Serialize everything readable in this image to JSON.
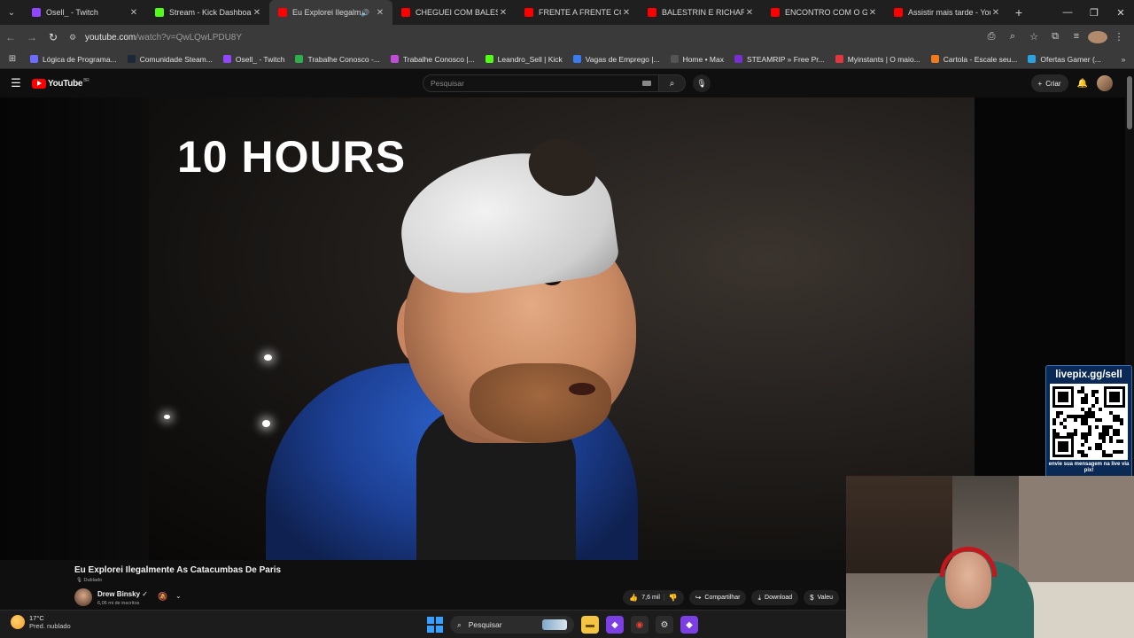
{
  "tabs": [
    {
      "label": "Osell_ - Twitch",
      "type": "twitch",
      "active": false
    },
    {
      "label": "Stream - Kick Dashboard",
      "type": "kick",
      "active": false
    },
    {
      "label": "Eu Explorei Ilegalmen",
      "type": "yt",
      "active": true
    },
    {
      "label": "CHEGUEI COM BALESTRIN",
      "type": "yt",
      "active": false
    },
    {
      "label": "FRENTE A FRENTE COM O",
      "type": "yt",
      "active": false
    },
    {
      "label": "BALESTRIN E RICHARD E",
      "type": "yt",
      "active": false
    },
    {
      "label": "ENCONTRO COM O GIGA",
      "type": "yt",
      "active": false
    },
    {
      "label": "Assistir mais tarde - YouT",
      "type": "yt",
      "active": false
    }
  ],
  "address": {
    "host": "youtube.com",
    "path": "/watch?v=QwLQwLPDU8Y"
  },
  "bookmarks": [
    {
      "label": "Lógica de Programa...",
      "color": "#6c6cff"
    },
    {
      "label": "Comunidade Steam...",
      "color": "#1b2838"
    },
    {
      "label": "Osell_ - Twitch",
      "color": "#9146ff"
    },
    {
      "label": "Trabalhe Conosco -...",
      "color": "#2fae4e"
    },
    {
      "label": "Trabalhe Conosco |...",
      "color": "#c04dd6"
    },
    {
      "label": "Leandro_Sell | Kick",
      "color": "#53fc18"
    },
    {
      "label": "Vagas de Emprego |...",
      "color": "#3a7bf0"
    },
    {
      "label": "Home • Max",
      "color": "#555555"
    },
    {
      "label": "STEAMRIP » Free Pr...",
      "color": "#7a2dd1"
    },
    {
      "label": "Myinstants | O maio...",
      "color": "#e0383e"
    },
    {
      "label": "Cartola - Escale seu...",
      "color": "#f07a1e"
    },
    {
      "label": "Ofertas Gamer (...",
      "color": "#2aa3e0"
    }
  ],
  "youtube": {
    "logo_text": "YouTube",
    "country": "BR",
    "search_placeholder": "Pesquisar",
    "create_label": "Criar"
  },
  "video": {
    "overlay_text": "10 HOURS",
    "title": "Eu Explorei Ilegalmente As Catacumbas De Paris",
    "dub_label": "Dublado",
    "channel_name": "Drew Binsky ✓",
    "channel_subs": "6,06 mi de inscritos",
    "likes": "7,6 mil",
    "share_label": "Compartilhar",
    "download_label": "Download",
    "thanks_label": "Valeu"
  },
  "livepix": {
    "title": "livepix.gg/sell",
    "subtitle": "envie sua mensagem na live via pix!"
  },
  "taskbar": {
    "temp": "17°C",
    "weather": "Pred. nublado",
    "search_label": "Pesquisar"
  },
  "colors": {
    "yt_red": "#ff0000",
    "jacket": "#1f4aa8",
    "livepix_bg": "#0a2a55"
  }
}
